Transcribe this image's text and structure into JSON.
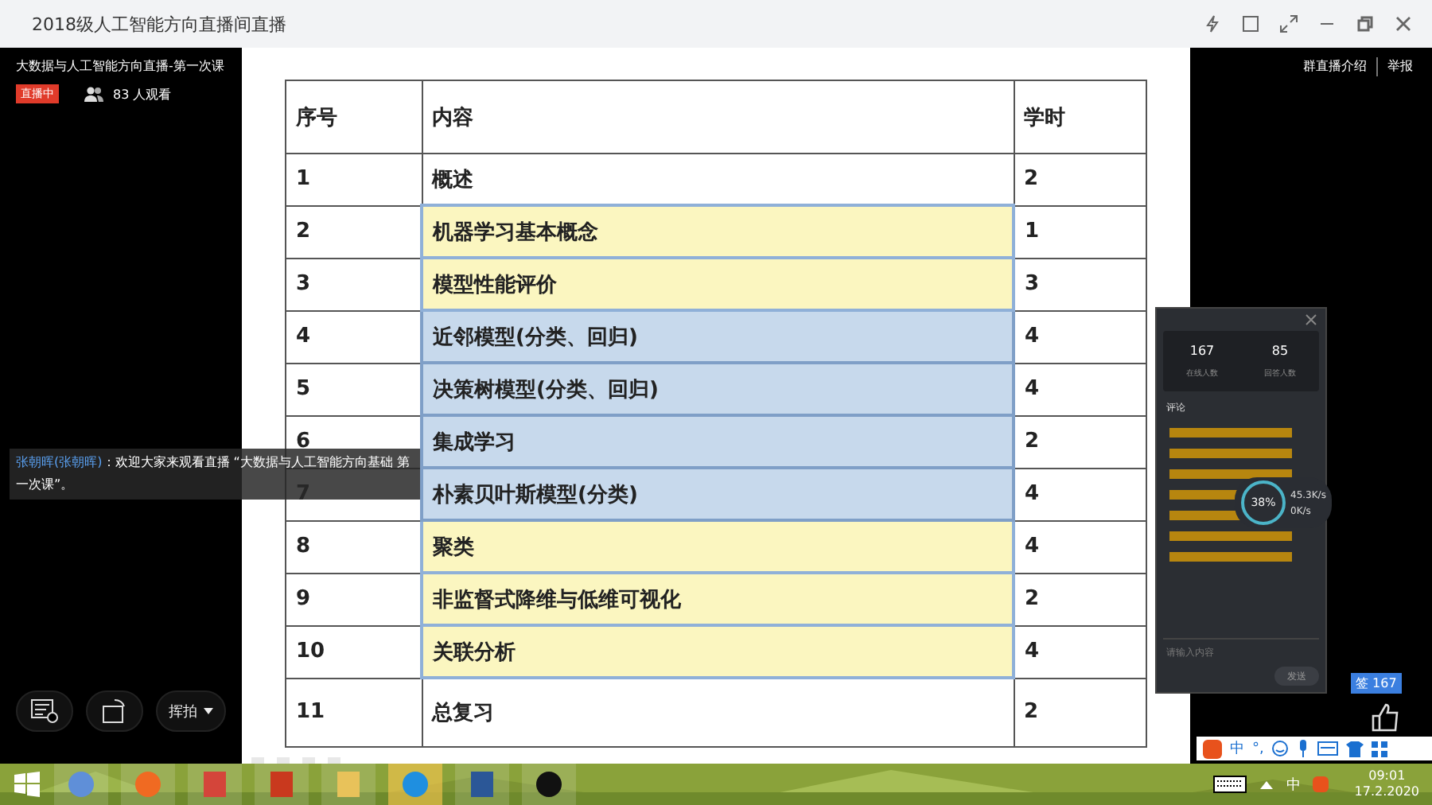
{
  "window": {
    "title": "2018级人工智能方向直播间直播"
  },
  "stream": {
    "title": "大数据与人工智能方向直播-第一次课",
    "status": "直播中",
    "viewers": "83 人观看",
    "links": [
      "群直播介绍",
      "举报"
    ]
  },
  "chat_overlay": {
    "author": "张朝晖(张朝晖)",
    "message": "：欢迎大家来观看直播 “大数据与人工智能方向基础 第一次课”。"
  },
  "table": {
    "columns": [
      "序号",
      "内容",
      "学时"
    ],
    "rows": [
      {
        "no": "1",
        "content": "概述",
        "hours": "2",
        "kind": "plain"
      },
      {
        "no": "2",
        "content": "机器学习基本概念",
        "hours": "1",
        "kind": "yellow"
      },
      {
        "no": "3",
        "content": "模型性能评价",
        "hours": "3",
        "kind": "yellow"
      },
      {
        "no": "4",
        "content": "近邻模型(分类、回归)",
        "hours": "4",
        "kind": "blue"
      },
      {
        "no": "5",
        "content": "决策树模型(分类、回归)",
        "hours": "4",
        "kind": "blue"
      },
      {
        "no": "6",
        "content": "集成学习",
        "hours": "2",
        "kind": "blue"
      },
      {
        "no": "7",
        "content": "朴素贝叶斯模型(分类)",
        "hours": "4",
        "kind": "blue"
      },
      {
        "no": "8",
        "content": "聚类",
        "hours": "4",
        "kind": "yellow"
      },
      {
        "no": "9",
        "content": "非监督式降维与低维可视化",
        "hours": "2",
        "kind": "yellow"
      },
      {
        "no": "10",
        "content": "关联分析",
        "hours": "4",
        "kind": "yellow"
      },
      {
        "no": "11",
        "content": "总复习",
        "hours": "2",
        "kind": "plain"
      }
    ]
  },
  "side_panel": {
    "stats": [
      {
        "value": "167",
        "label": "在线人数"
      },
      {
        "value": "85",
        "label": "回答人数"
      }
    ],
    "heading": "评论",
    "placeholder": "请输入内容",
    "send": "发送"
  },
  "speed_widget": {
    "percent": "38%",
    "up": "45.3K/s",
    "down": "0K/s"
  },
  "controls": {
    "mode": "挥拍",
    "sign_in": "签 167"
  },
  "ime_bar": [
    "中",
    "°,"
  ],
  "clock": {
    "time": "09:01",
    "date": "17.2.2020"
  },
  "tray_lang": "中"
}
